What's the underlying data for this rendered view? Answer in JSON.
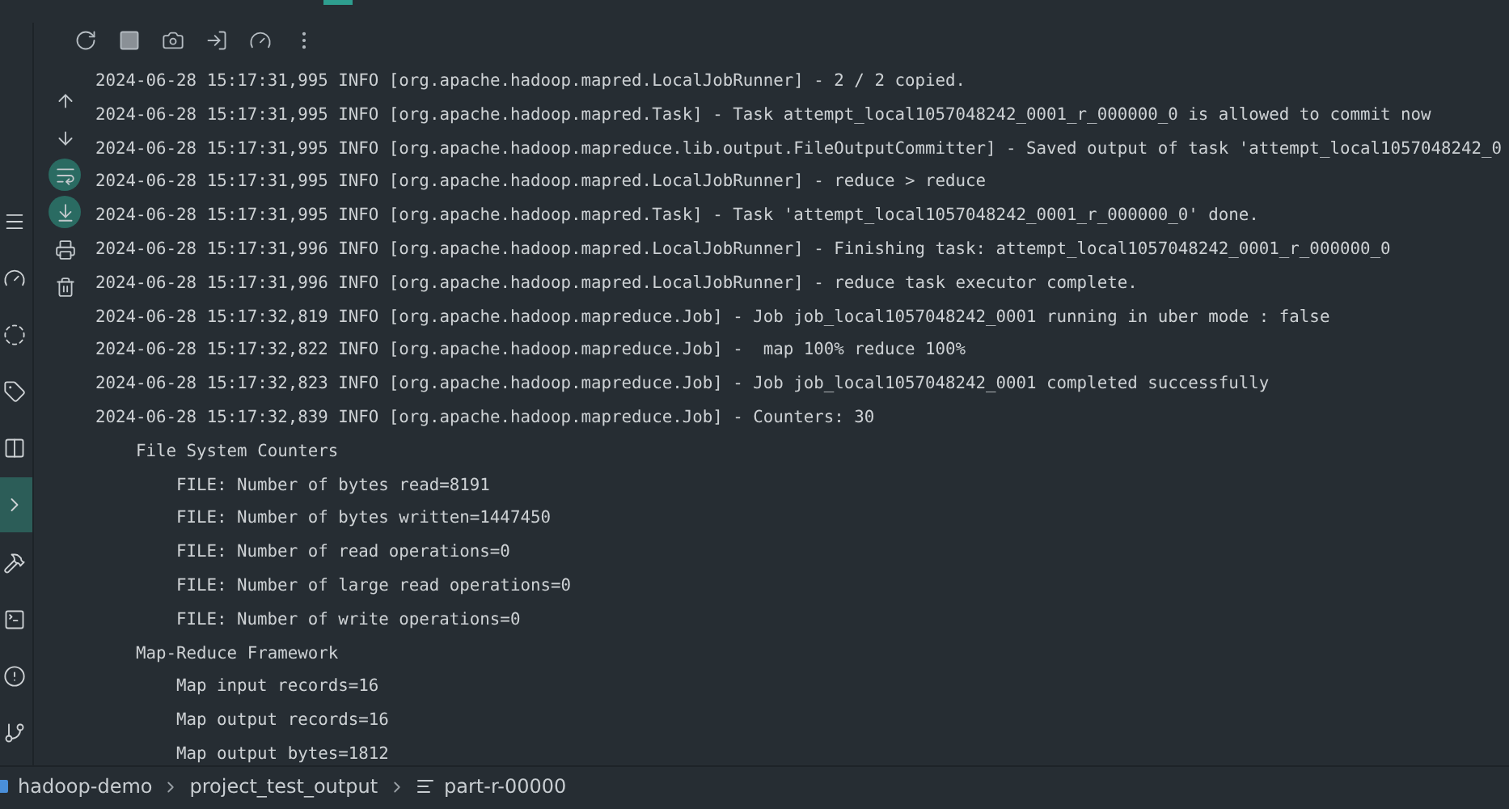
{
  "tab_indicator": {
    "selected": true
  },
  "toolbar": [
    {
      "kind": "rerun"
    },
    {
      "kind": "stop"
    },
    {
      "kind": "screenshot"
    },
    {
      "kind": "exit"
    },
    {
      "kind": "profiler"
    },
    {
      "kind": "more"
    }
  ],
  "tool_strip": [
    {
      "kind": "menu",
      "selected": false
    },
    {
      "kind": "gauge",
      "selected": false
    },
    {
      "kind": "wave",
      "selected": false
    },
    {
      "kind": "tag",
      "selected": false
    },
    {
      "kind": "layout",
      "selected": false
    },
    {
      "kind": "run",
      "selected": true
    },
    {
      "kind": "hammer",
      "selected": false
    },
    {
      "kind": "terminal",
      "selected": false
    },
    {
      "kind": "alert",
      "selected": false
    },
    {
      "kind": "git",
      "selected": false
    }
  ],
  "side_actions": [
    {
      "kind": "up",
      "on": false
    },
    {
      "kind": "down",
      "on": false
    },
    {
      "kind": "wrap",
      "on": true
    },
    {
      "kind": "scroll_end",
      "on": true
    },
    {
      "kind": "print",
      "on": false
    },
    {
      "kind": "clear",
      "on": false
    }
  ],
  "log": [
    {
      "text": "2024-06-28 15:17:31,995 INFO [org.apache.hadoop.mapred.LocalJobRunner] - 2 / 2 copied."
    },
    {
      "text": "2024-06-28 15:17:31,995 INFO [org.apache.hadoop.mapred.Task] - Task attempt_local1057048242_0001_r_000000_0 is allowed to commit now"
    },
    {
      "text": "2024-06-28 15:17:31,995 INFO [org.apache.hadoop.mapreduce.lib.output.FileOutputCommitter] - Saved output of task 'attempt_local1057048242_0"
    },
    {
      "text": "2024-06-28 15:17:31,995 INFO [org.apache.hadoop.mapred.LocalJobRunner] - reduce > reduce"
    },
    {
      "text": "2024-06-28 15:17:31,995 INFO [org.apache.hadoop.mapred.Task] - Task 'attempt_local1057048242_0001_r_000000_0' done."
    },
    {
      "text": "2024-06-28 15:17:31,996 INFO [org.apache.hadoop.mapred.LocalJobRunner] - Finishing task: attempt_local1057048242_0001_r_000000_0"
    },
    {
      "text": "2024-06-28 15:17:31,996 INFO [org.apache.hadoop.mapred.LocalJobRunner] - reduce task executor complete."
    },
    {
      "text": "2024-06-28 15:17:32,819 INFO [org.apache.hadoop.mapreduce.Job] - Job job_local1057048242_0001 running in uber mode : false"
    },
    {
      "text": "2024-06-28 15:17:32,822 INFO [org.apache.hadoop.mapreduce.Job] -  map 100% reduce 100%"
    },
    {
      "text": "2024-06-28 15:17:32,823 INFO [org.apache.hadoop.mapreduce.Job] - Job job_local1057048242_0001 completed successfully"
    },
    {
      "text": "2024-06-28 15:17:32,839 INFO [org.apache.hadoop.mapreduce.Job] - Counters: 30",
      "children": [
        {
          "text": "File System Counters",
          "children": [
            {
              "text": "FILE: Number of bytes read=8191"
            },
            {
              "text": "FILE: Number of bytes written=1447450"
            },
            {
              "text": "FILE: Number of read operations=0"
            },
            {
              "text": "FILE: Number of large read operations=0"
            },
            {
              "text": "FILE: Number of write operations=0"
            }
          ]
        },
        {
          "text": "Map-Reduce Framework",
          "children": [
            {
              "text": "Map input records=16"
            },
            {
              "text": "Map output records=16"
            },
            {
              "text": "Map output bytes=1812"
            }
          ]
        }
      ]
    }
  ],
  "breadcrumbs": [
    {
      "text": "hadoop-demo",
      "kind": "module"
    },
    {
      "text": "project_test_output",
      "kind": "folder"
    },
    {
      "text": "part-r-00000",
      "kind": "file"
    }
  ]
}
